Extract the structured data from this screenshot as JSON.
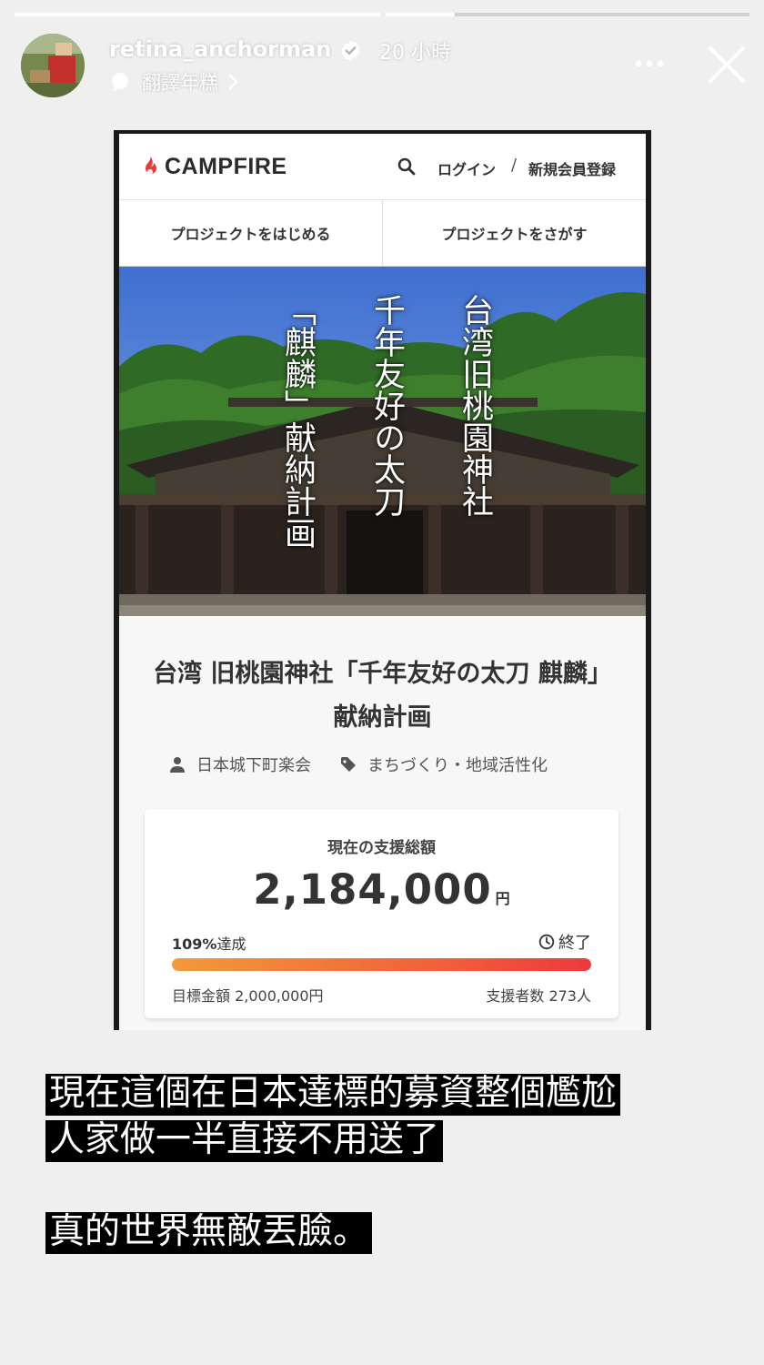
{
  "story": {
    "progress": [
      1.0,
      0.19
    ],
    "username": "retina_anchorman",
    "time": "20 小時",
    "translate_label": "翻譯年糕",
    "icons": [
      "verified-icon",
      "translate-icon",
      "chevron-right-icon",
      "more-icon",
      "close-icon"
    ]
  },
  "shared": {
    "site": {
      "logo_text": "CAMPFIRE",
      "login": "ログイン",
      "slash": "/",
      "signup": "新規会員登録",
      "tab_start": "プロジェクトをはじめる",
      "tab_find": "プロジェクトをさがす"
    },
    "hero_columns": [
      "台湾旧桃園神社",
      "千年友好の太刀",
      "「麒麟」献納計画"
    ],
    "project": {
      "title": "台湾 旧桃園神社「千年友好の太刀 麒麟」献納計画",
      "owner": "日本城下町楽会",
      "category": "まちづくり・地域活性化",
      "fund_label": "現在の支援総額",
      "amount": "2,184,000",
      "currency": "円",
      "achieve_pct": "109%",
      "achieve_suffix": "達成",
      "status": "終了",
      "progress_fraction": 1.0,
      "goal": "目標金額 2,000,000円",
      "backers": "支援者数 273人"
    },
    "colors": {
      "campfire_red": "#ec3a3a",
      "bar_start": "#f39a3a",
      "bar_end": "#ec3a3a"
    }
  },
  "captions": {
    "line1": "現在這個在日本達標的募資整個尷尬",
    "line2": "人家做一半直接不用送了",
    "line3": "真的世界無敵丟臉。"
  }
}
